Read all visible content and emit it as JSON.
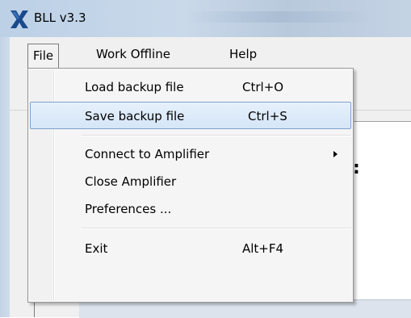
{
  "window": {
    "title": "BLL v3.3"
  },
  "menubar": {
    "file": "File",
    "work_offline": "Work Offline",
    "help": "Help"
  },
  "file_menu": {
    "items": [
      {
        "label": "Load backup file",
        "shortcut": "Ctrl+O"
      },
      {
        "label": "Save backup file",
        "shortcut": "Ctrl+S",
        "highlighted": true
      },
      {
        "label": "Connect to Amplifier",
        "submenu": true
      },
      {
        "label": "Close Amplifier"
      },
      {
        "label": "Preferences ..."
      },
      {
        "label": "Exit",
        "shortcut": "Alt+F4"
      }
    ]
  },
  "background": {
    "partial_text": ":"
  },
  "colors": {
    "highlight_border": "#7da2ce",
    "highlight_fill": "#d5e6f8",
    "titlebar": "#c9d9ea",
    "icon_blue": "#1a4a8c"
  },
  "icons": {
    "app": "x-logo-icon",
    "submenu": "triangle-right-icon"
  }
}
